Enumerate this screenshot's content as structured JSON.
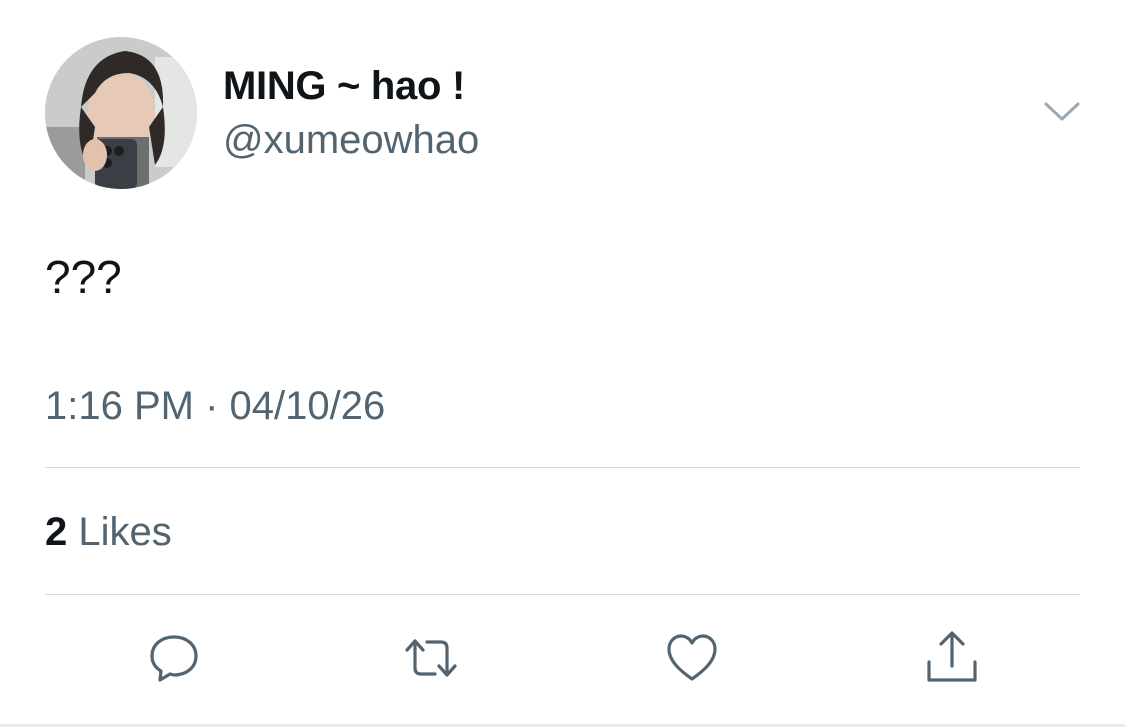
{
  "tweet": {
    "display_name": "MING ~ hao !",
    "handle": "@xumeowhao",
    "text": "???",
    "time": "1:16 PM",
    "separator": "·",
    "date": "04/10/26",
    "likes_count": "2",
    "likes_label": "Likes"
  },
  "icons": {
    "menu": "chevron-down-icon",
    "reply": "speech-bubble-icon",
    "retweet": "retweet-arrows-icon",
    "like": "heart-icon",
    "share": "share-upload-icon"
  },
  "colors": {
    "primary_text": "#0f1419",
    "secondary_text": "#536471",
    "divider": "#cfd9de"
  }
}
